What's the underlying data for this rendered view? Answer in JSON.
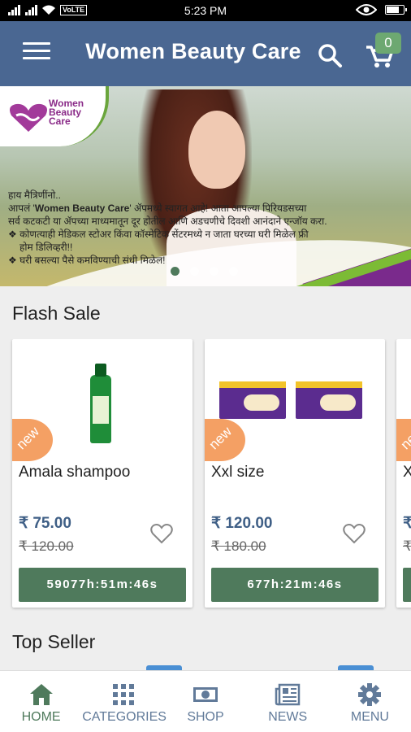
{
  "status_bar": {
    "time": "5:23 PM",
    "network": "VoLTE"
  },
  "app_bar": {
    "title": "Women Beauty Care",
    "cart_count": "0"
  },
  "banner": {
    "logo_lines": [
      "Women",
      "Beauty",
      "Care"
    ],
    "line1": "हाय मैत्रिणींनो..",
    "line2_pre": "आपलं '",
    "line2_brand": "Women Beauty Care",
    "line2_post": "' ॲपमध्ये स्वागत आहे! आता आपल्या पिरियडसच्या",
    "line3": "सर्व कटकटी या ॲपच्या माध्यमातून दूर होतील आणि अडचणीचे दिवशी आनंदाने एन्जॉय करा.",
    "line4": "❖ कोणत्याही मेडिकल स्टोअर किंवा कॉस्मेटिक सेंटरमध्ये न जाता घरच्या घरी मिळेल फ्री",
    "line5": "होम डिलिव्हरी!!",
    "line6": "❖ घरी बसल्या पैसे कमविण्याची संधी मिळेल!",
    "slides_total": 4,
    "active_slide": 1
  },
  "flash_sale": {
    "title": "Flash Sale",
    "new_label": "new",
    "products": [
      {
        "name": "Amala shampoo",
        "price": "₹ 75.00",
        "old_price": "₹ 120.00",
        "timer": "59077h:51m:46s"
      },
      {
        "name": "Xxl size",
        "price": "₹ 120.00",
        "old_price": "₹ 180.00",
        "timer": "677h:21m:46s"
      },
      {
        "name": "X",
        "price": "₹",
        "old_price": "₹",
        "timer": ""
      }
    ]
  },
  "top_seller": {
    "title": "Top Seller"
  },
  "bottom_nav": {
    "items": [
      {
        "label": "HOME",
        "icon": "home-icon",
        "active": true
      },
      {
        "label": "CATEGORIES",
        "icon": "grid-icon",
        "active": false
      },
      {
        "label": "SHOP",
        "icon": "money-icon",
        "active": false
      },
      {
        "label": "NEWS",
        "icon": "news-icon",
        "active": false
      },
      {
        "label": "MENU",
        "icon": "gear-icon",
        "active": false
      }
    ]
  },
  "colors": {
    "app_bar": "#4a6792",
    "accent_green": "#4f7a5c",
    "price_blue": "#3f5f86",
    "new_tag": "#f4a064"
  }
}
